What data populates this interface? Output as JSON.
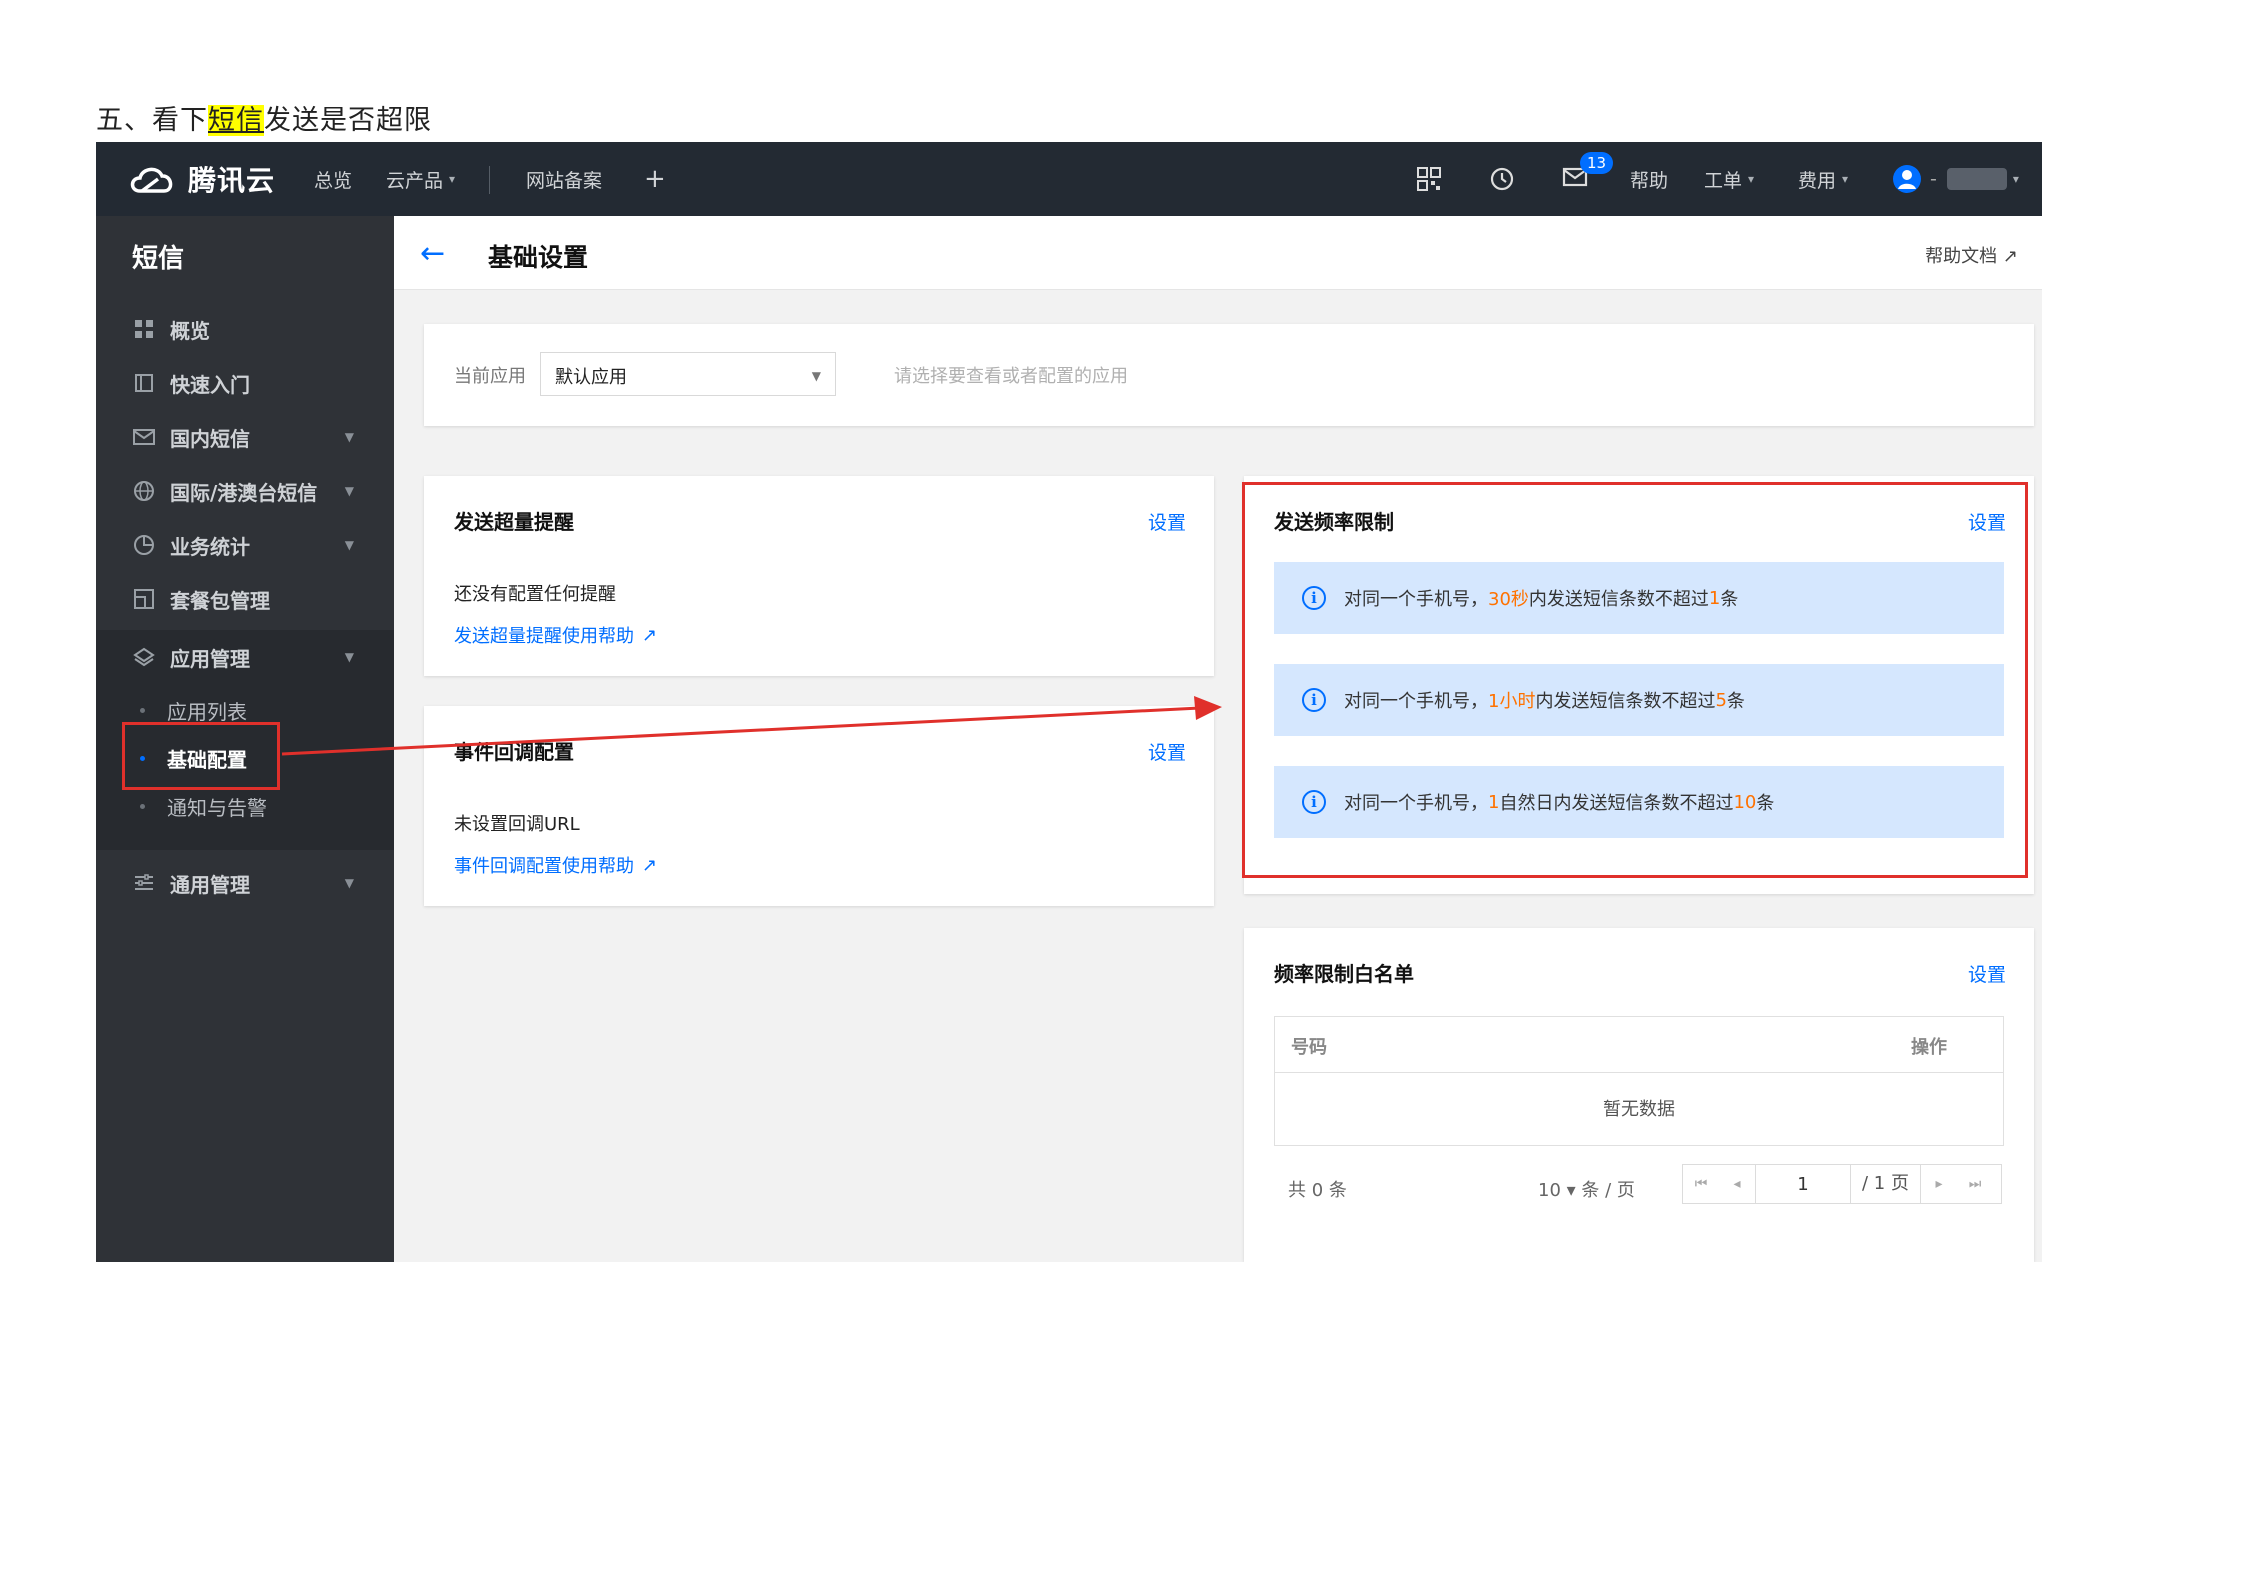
{
  "doc": {
    "heading_before": "五、看下",
    "heading_highlight": "短信",
    "heading_after": "发送是否超限"
  },
  "topbar": {
    "brand": "腾讯云",
    "nav": [
      "总览",
      "云产品",
      "网站备案",
      "+"
    ],
    "mail_badge": "13",
    "help": "帮助",
    "ticket": "工单",
    "billing": "费用",
    "user_dash": "-"
  },
  "sidebar": {
    "title": "短信",
    "items": {
      "overview": "概览",
      "quickstart": "快速入门",
      "domestic": "国内短信",
      "international": "国际/港澳台短信",
      "stats": "业务统计",
      "package": "套餐包管理",
      "app_mgmt": "应用管理",
      "app_list": "应用列表",
      "basic_config": "基础配置",
      "notify_alert": "通知与告警",
      "general_mgmt": "通用管理"
    }
  },
  "page": {
    "title": "基础设置",
    "help_doc": "帮助文档"
  },
  "app_select": {
    "label": "当前应用",
    "value": "默认应用",
    "hint": "请选择要查看或者配置的应用"
  },
  "overquota": {
    "title": "发送超量提醒",
    "setting": "设置",
    "status": "还没有配置任何提醒",
    "help": "发送超量提醒使用帮助"
  },
  "callback": {
    "title": "事件回调配置",
    "setting": "设置",
    "status": "未设置回调URL",
    "help": "事件回调配置使用帮助"
  },
  "freq": {
    "title": "发送频率限制",
    "setting": "设置",
    "rules": [
      {
        "pre": "对同一个手机号，",
        "hl1": "30秒",
        "mid": " 内发送短信条数不超过",
        "hl2": "1",
        "post": "条"
      },
      {
        "pre": "对同一个手机号，",
        "hl1": "1小时",
        "mid": "内发送短信条数不超过",
        "hl2": "5",
        "post": "条"
      },
      {
        "pre": "对同一个手机号，",
        "hl1": "1",
        "mid": " 自然日内发送短信条数不超过",
        "hl2": "10",
        "post": "条"
      }
    ]
  },
  "whitelist": {
    "title": "频率限制白名单",
    "setting": "设置",
    "col_number": "号码",
    "col_action": "操作",
    "empty": "暂无数据",
    "total": "共 0 条",
    "page_size": "10 ▾ 条 / 页",
    "page_current": "1",
    "page_total": "/ 1 页"
  },
  "colors": {
    "topbar_bg": "#232a33",
    "sidebar_bg": "#2f3237",
    "accent": "#006eff",
    "annotation_red": "#e0302b",
    "notice_bg": "#d5e7fe",
    "highlight_orange": "#ff7200"
  },
  "icons": [
    "cloud-logo-icon",
    "qr-icon",
    "clock-icon",
    "mail-icon",
    "user-avatar-icon",
    "grid-icon",
    "book-icon",
    "envelope-icon",
    "globe-icon",
    "pie-chart-icon",
    "package-icon",
    "layers-icon",
    "sliders-icon",
    "back-arrow-icon",
    "external-link-icon",
    "info-icon"
  ]
}
